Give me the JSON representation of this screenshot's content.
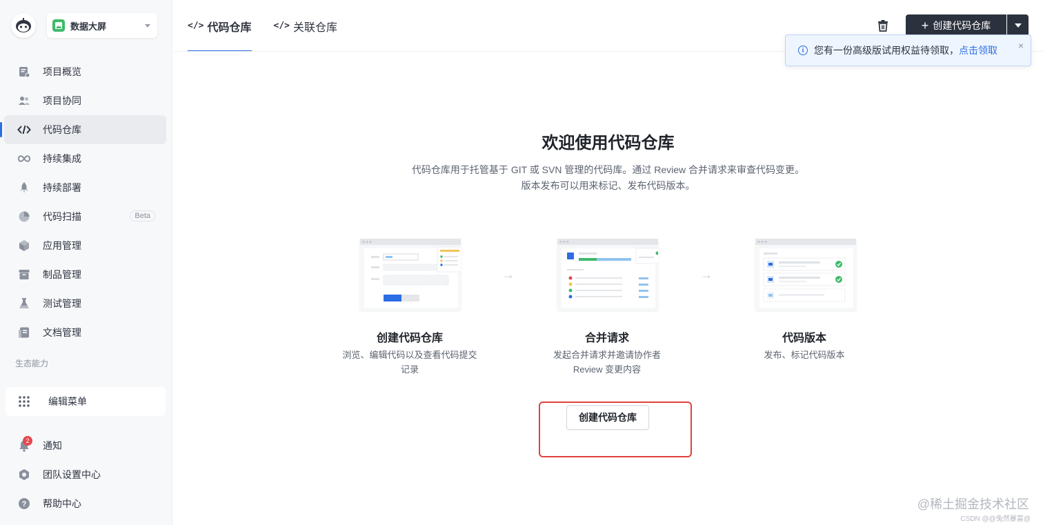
{
  "project": {
    "name": "数据大屏",
    "logo_icon": "robot-logo-icon"
  },
  "nav": [
    {
      "label": "项目概览",
      "icon": "overview-icon"
    },
    {
      "label": "项目协同",
      "icon": "people-icon"
    },
    {
      "label": "代码仓库",
      "icon": "code-icon",
      "active": true
    },
    {
      "label": "持续集成",
      "icon": "infinity-icon"
    },
    {
      "label": "持续部署",
      "icon": "rocket-icon"
    },
    {
      "label": "代码扫描",
      "icon": "pie-icon",
      "badge": "Beta"
    },
    {
      "label": "应用管理",
      "icon": "cube-icon"
    },
    {
      "label": "制品管理",
      "icon": "box-icon"
    },
    {
      "label": "测试管理",
      "icon": "flask-icon"
    },
    {
      "label": "文档管理",
      "icon": "doc-icon"
    }
  ],
  "ecosystem": {
    "title": "生态能力",
    "edit_menu": "编辑菜单"
  },
  "bottom_nav": [
    {
      "label": "通知",
      "icon": "bell-icon",
      "badge": "2"
    },
    {
      "label": "团队设置中心",
      "icon": "settings-icon"
    },
    {
      "label": "帮助中心",
      "icon": "help-icon"
    }
  ],
  "tabs": [
    {
      "label": "代码仓库",
      "icon_text": "</>",
      "active": true
    },
    {
      "label": "关联仓库",
      "icon_text": "</>"
    }
  ],
  "header": {
    "create_label": "创建代码仓库",
    "create_plus": "+"
  },
  "notice": {
    "text": "您有一份高级版试用权益待领取，",
    "link": "点击领取",
    "close": "×",
    "info": "i"
  },
  "welcome": {
    "title": "欢迎使用代码仓库",
    "desc_line1": "代码仓库用于托管基于 GIT 或 SVN 管理的代码库。通过 Review 合并请求来审查代码变更。",
    "desc_line2": "版本发布可以用来标记、发布代码版本。"
  },
  "steps": [
    {
      "title": "创建代码仓库",
      "desc_line1": "浏览、编辑代码以及查看代码提交",
      "desc_line2": "记录"
    },
    {
      "title": "合并请求",
      "desc_line1": "发起合并请求并邀请协作者",
      "desc_line2": "Review 变更内容"
    },
    {
      "title": "代码版本",
      "desc_line1": "发布、标记代码版本",
      "desc_line2": ""
    }
  ],
  "arrow_glyph": "→",
  "cta_label": "创建代码仓库",
  "watermark": {
    "main": "@稀土掘金技术社区",
    "sub": "CSDN @@兔然暴富@"
  },
  "colors": {
    "primary": "#2b6de5",
    "dark_button": "#2b313d",
    "highlight": "#e0413a",
    "success": "#3fba6b"
  }
}
